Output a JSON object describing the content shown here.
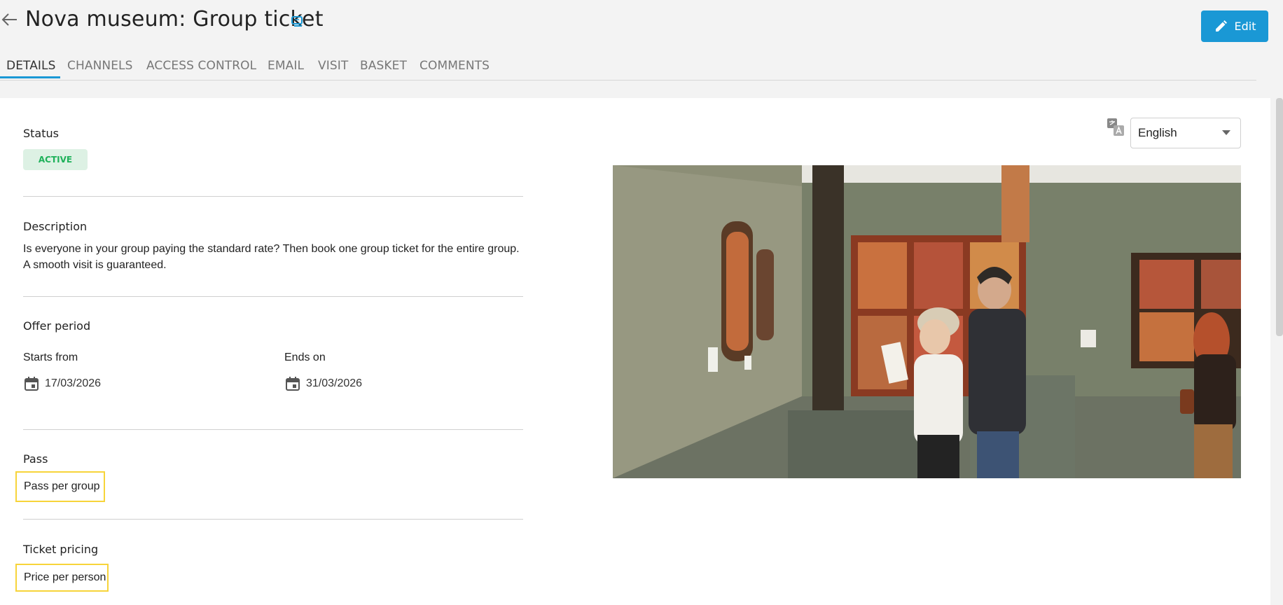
{
  "header": {
    "title": "Nova museum: Group ticket",
    "edit_label": "Edit"
  },
  "tabs": [
    {
      "label": "DETAILS",
      "active": true
    },
    {
      "label": "CHANNELS"
    },
    {
      "label": "ACCESS CONTROL"
    },
    {
      "label": "EMAIL"
    },
    {
      "label": "VISIT"
    },
    {
      "label": "BASKET"
    },
    {
      "label": "COMMENTS"
    }
  ],
  "status": {
    "label": "Status",
    "value": "ACTIVE"
  },
  "description": {
    "label": "Description",
    "text": "Is everyone in your group paying the standard rate? Then book one group ticket for the entire group. A smooth visit is guaranteed."
  },
  "offer_period": {
    "label": "Offer period",
    "starts_label": "Starts from",
    "starts_value": "17/03/2026",
    "ends_label": "Ends on",
    "ends_value": "31/03/2026"
  },
  "pass": {
    "label": "Pass",
    "value": "Pass per group"
  },
  "ticket_pricing": {
    "label": "Ticket pricing",
    "value": "Price per person"
  },
  "language": {
    "selected": "English"
  },
  "colors": {
    "accent": "#1a98d5",
    "status_bg": "#ddf1e4",
    "status_text": "#1eb15a",
    "highlight": "#f7d43a"
  }
}
